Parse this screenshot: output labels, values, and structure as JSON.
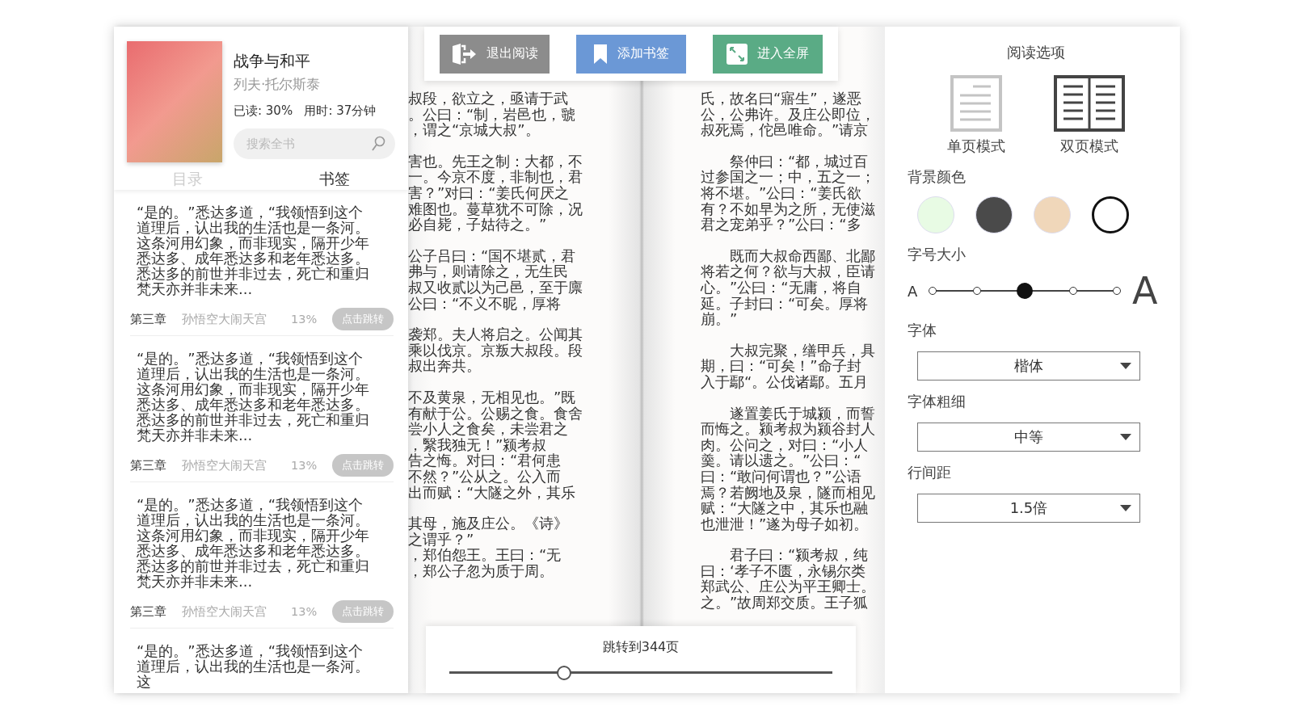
{
  "book": {
    "title": "战争与和平",
    "author": "列夫·托尔斯泰",
    "stats": "已读: 30%   用时: 37分钟",
    "search": {
      "placeholder": "搜索全书"
    }
  },
  "tabs": [
    {
      "label": "目录",
      "selected": false
    },
    {
      "label": "书签",
      "selected": true
    }
  ],
  "bookmarks": [
    {
      "text": "“是的。”悉达多道，“我领悟到这个道理后，认出我的生活也是一条河。这条河用幻象，而非现实，隔开少年悉达多、成年悉达多和老年悉达多。悉达多的前世并非过去，死亡和重归梵天亦并非未来...",
      "chapter": "第三章",
      "section": "孙悟空大闹天宫",
      "percent": "13%",
      "button": "点击跳转"
    },
    {
      "text": "“是的。”悉达多道，“我领悟到这个道理后，认出我的生活也是一条河。这条河用幻象，而非现实，隔开少年悉达多、成年悉达多和老年悉达多。悉达多的前世并非过去，死亡和重归梵天亦并非未来...",
      "chapter": "第三章",
      "section": "孙悟空大闹天宫",
      "percent": "13%",
      "button": "点击跳转"
    },
    {
      "text": "“是的。”悉达多道，“我领悟到这个道理后，认出我的生活也是一条河。这条河用幻象，而非现实，隔开少年悉达多、成年悉达多和老年悉达多。悉达多的前世并非过去，死亡和重归梵天亦并非未来...",
      "chapter": "第三章",
      "section": "孙悟空大闹天宫",
      "percent": "13%",
      "button": "点击跳转"
    },
    {
      "text": "“是的。”悉达多道，“我领悟到这个道理后，认出我的生活也是一条河。这"
    }
  ],
  "toolbar": [
    {
      "kind": "exit",
      "label": "退出阅读",
      "color": "#8c8c8c"
    },
    {
      "kind": "bookmark",
      "label": "添加书签",
      "color": "#6b98d6"
    },
    {
      "kind": "fullscreen",
      "label": "进入全屏",
      "color": "#5aab85"
    }
  ],
  "pages": [
    {
      "paragraphs": [
        {
          "indented": false,
          "lines": [
            "叔段，欲立之，亟请于武",
            "。公曰：“制，岩邑也，虢",
            "，谓之“京城大叔”。"
          ]
        },
        {
          "indented": false,
          "lines": [
            "害也。先王之制：大都，不",
            "一。今京不度，非制也，君",
            "害？”对曰：“姜氏何厌之",
            "难图也。蔓草犹不可除，况",
            "必自毙，子姑待之。”"
          ]
        },
        {
          "indented": false,
          "lines": [
            "公子吕曰：“国不堪贰，君",
            "弗与，则请除之，无生民",
            "叔又收贰以为己邑，至于廪",
            "公曰：“不义不昵，厚将"
          ]
        },
        {
          "indented": false,
          "lines": [
            "袭郑。夫人将启之。公闻其",
            "乘以伐京。京叛大叔段。段",
            "叔出奔共。"
          ]
        },
        {
          "indented": false,
          "lines": [
            "不及黄泉，无相见也。”既",
            "有献于公。公赐之食。食舍",
            "尝小人之食矣，未尝君之",
            "，繄我独无！”颍考叔",
            "告之悔。对曰：“君何患",
            "不然？”公从之。公入而",
            "出而赋：“大隧之外，其乐"
          ]
        },
        {
          "indented": false,
          "lines": [
            "其母，施及庄公。《诗》",
            "之谓乎？”",
            "，郑伯怨王。王曰：“无",
            "，郑公子忽为质于周。"
          ]
        }
      ]
    },
    {
      "paragraphs": [
        {
          "indented": false,
          "lines": [
            "氏，故名曰“寤生”，遂恶",
            "公，公弗许。及庄公即位，",
            "叔死焉，佗邑唯命。”请京"
          ]
        },
        {
          "indented": true,
          "lines": [
            "祭仲曰：“都，城过百",
            "过参国之一；中，五之一；",
            "将不堪。”公曰：“姜氏欲",
            "有？不如早为之所，无使滋",
            "君之宠弟乎？”公曰：“多"
          ]
        },
        {
          "indented": true,
          "lines": [
            "既而大叔命西鄙、北鄙",
            "将若之何？欲与大叔，臣请",
            "心。”公曰：“无庸，将自",
            "延。子封曰：“可矣。厚将",
            "崩。”"
          ]
        },
        {
          "indented": true,
          "lines": [
            "大叔完聚，缮甲兵，具",
            "期，曰：“可矣！”命子封",
            "入于鄢“。公伐诸鄢。五月"
          ]
        },
        {
          "indented": true,
          "lines": [
            "遂置姜氏于城颍，而誓",
            "而悔之。颍考叔为颍谷封人",
            "肉。公问之，对曰：“小人",
            "羹。请以遗之。”公曰：“",
            "曰：“敢问何谓也？”公语",
            "焉？若阙地及泉，隧而相见",
            "赋：“大隧之中，其乐也融",
            "也泄泄！”遂为母子如初。"
          ]
        },
        {
          "indented": true,
          "lines": [
            "君子曰：“颍考叔，纯",
            "曰：‘孝子不匮，永锡尔类",
            "郑武公、庄公为平王卿士。",
            "之。”故周郑交质。王子狐"
          ]
        }
      ]
    }
  ],
  "page_jump": {
    "label": "跳转到344页",
    "level": 0.3
  },
  "options": {
    "title": "阅读选项",
    "modes": [
      {
        "kind": "single",
        "label": "单页模式",
        "selected": false
      },
      {
        "kind": "double",
        "label": "双页模式",
        "selected": true
      }
    ],
    "background": {
      "label": "背景颜色",
      "swatches": [
        {
          "color": "#e8fbe4",
          "selected": false
        },
        {
          "color": "#4a4a4a",
          "selected": false
        },
        {
          "color": "#f0d7ba",
          "selected": false
        },
        {
          "color": "#ffffff",
          "selected": true
        }
      ]
    },
    "font_size": {
      "label": "字号大小",
      "small": "A",
      "large": "A",
      "steps": [
        {
          "selected": false
        },
        {
          "selected": false
        },
        {
          "selected": true
        },
        {
          "selected": false
        },
        {
          "selected": false
        }
      ]
    },
    "selects": [
      {
        "label": "字体",
        "value": "楷体"
      },
      {
        "label": "字体粗细",
        "value": "中等"
      },
      {
        "label": "行间距",
        "value": "1.5倍"
      }
    ]
  }
}
